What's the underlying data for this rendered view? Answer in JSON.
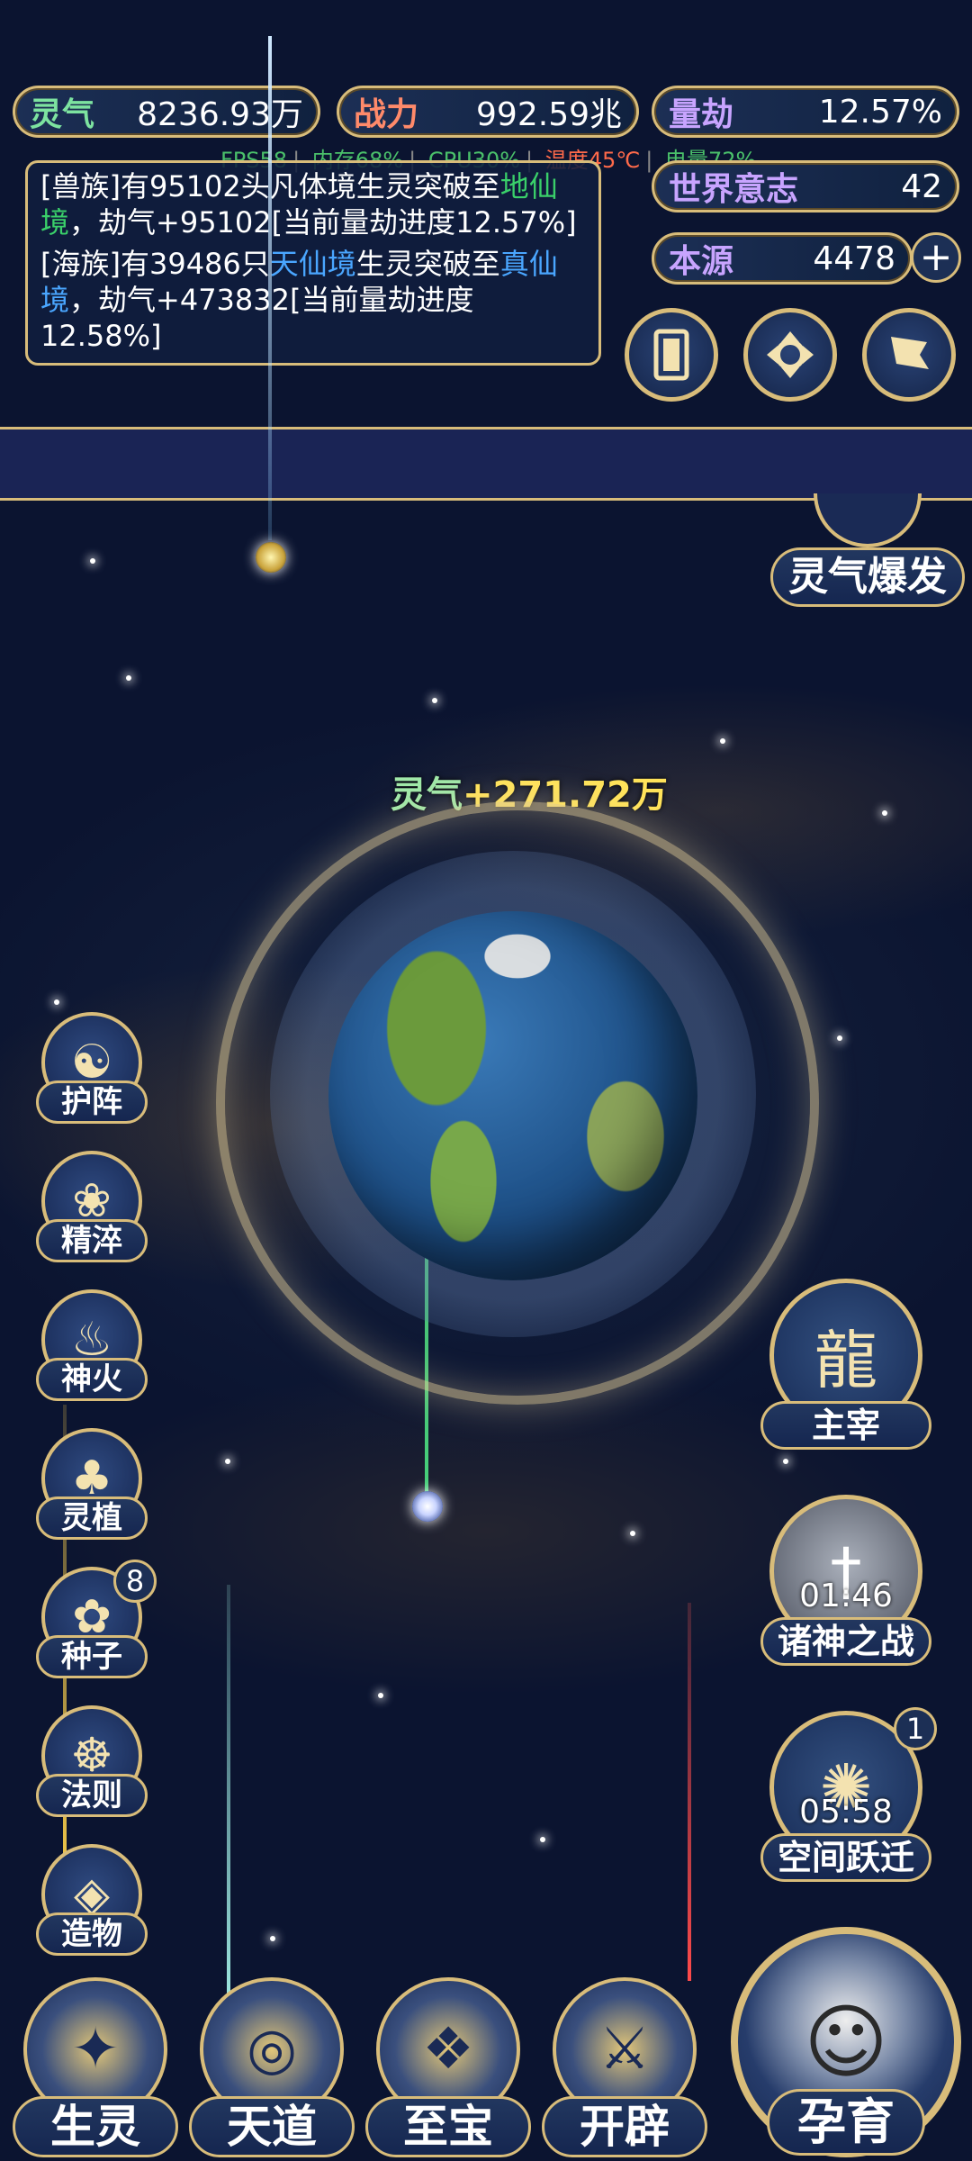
{
  "stats": {
    "lingqi": {
      "label": "灵气",
      "value": "8236.93万"
    },
    "zhanli": {
      "label": "战力",
      "value": "992.59兆"
    },
    "liangjie": {
      "label": "量劫",
      "value": "12.57%"
    },
    "shijie": {
      "label": "世界意志",
      "value": "42"
    },
    "benyuan": {
      "label": "本源",
      "value": "4478"
    }
  },
  "perf": {
    "fps": "FPS58",
    "mem": "内存68%",
    "cpu": "CPU30%",
    "temp": "温度45℃",
    "battery": "电量72%"
  },
  "log": [
    {
      "a": "[兽族]有95102头凡体境生灵突破至",
      "b": "地仙境",
      "c": "，劫气+95102[当前量劫进度12.57%]"
    },
    {
      "a": "[海族]有39486只",
      "b": "天仙境",
      "c": "生灵突破至",
      "d": "真仙境",
      "e": "，劫气+473832[当前量劫进度12.58%]"
    }
  ],
  "gain": {
    "label": "灵气",
    "value": "+271.72万"
  },
  "burst": "灵气爆发",
  "left_buttons": [
    {
      "label": "护阵",
      "icon": "yin-yang-icon"
    },
    {
      "label": "精淬",
      "icon": "lotus-icon"
    },
    {
      "label": "神火",
      "icon": "flame-icon"
    },
    {
      "label": "灵植",
      "icon": "plant-icon"
    },
    {
      "label": "种子",
      "icon": "seed-icon",
      "badge": "8"
    },
    {
      "label": "法则",
      "icon": "rune-icon"
    },
    {
      "label": "造物",
      "icon": "creation-icon"
    }
  ],
  "right_buttons": [
    {
      "label": "主宰",
      "icon": "dragon-icon"
    },
    {
      "label": "诸神之战",
      "icon": "sword-icon",
      "timer": "01:46"
    },
    {
      "label": "空间跃迁",
      "icon": "warp-icon",
      "timer": "05:58",
      "badge": "1"
    }
  ],
  "bottom_buttons": [
    {
      "label": "生灵",
      "icon": "phoenix-icon"
    },
    {
      "label": "天道",
      "icon": "wave-icon"
    },
    {
      "label": "至宝",
      "icon": "treasure-icon"
    },
    {
      "label": "开辟",
      "icon": "axe-icon"
    }
  ],
  "yunyu": {
    "label": "孕育",
    "icon": "silhouette-icon"
  },
  "colors": {
    "gold": "#d8bc7a",
    "panel": "#152650",
    "highlight_green": "#3ad06a",
    "highlight_blue": "#4aa6ff"
  }
}
